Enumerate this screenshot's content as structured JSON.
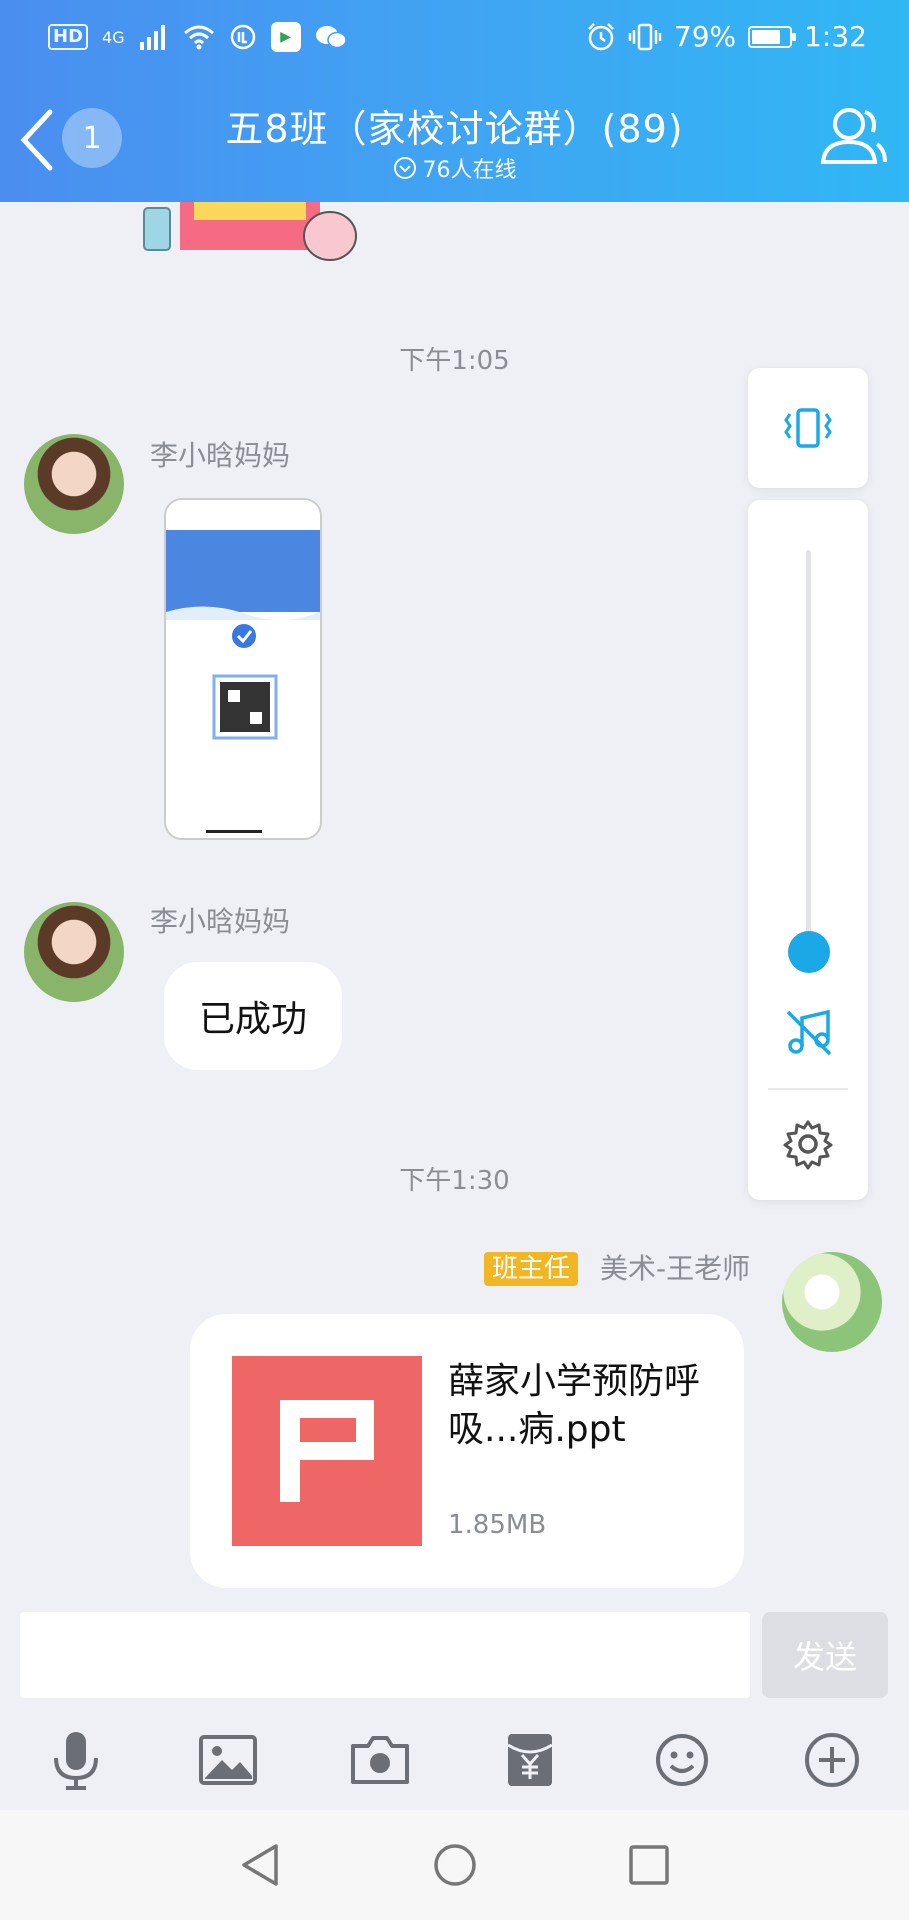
{
  "status_bar": {
    "hd": "HD",
    "network": "4G",
    "battery_percent": "79%",
    "battery_level": 0.79,
    "time": "1:32"
  },
  "header": {
    "back_badge": "1",
    "title": "五8班（家校讨论群）(89)",
    "online": "76人在线"
  },
  "messages": [
    {
      "type": "time",
      "text": "下午1:05"
    },
    {
      "type": "image",
      "sender": "李小晗妈妈"
    },
    {
      "type": "text",
      "sender": "李小晗妈妈",
      "text": "已成功"
    },
    {
      "type": "time",
      "text": "下午1:30"
    },
    {
      "type": "file",
      "role_badge": "班主任",
      "sender": "美术-王老师",
      "file_name": "薛家小学预防呼吸...病.ppt",
      "file_size": "1.85MB"
    }
  ],
  "volume_panel": {
    "level": 0.0
  },
  "input": {
    "placeholder": "",
    "send_label": "发送"
  },
  "toolbar": [
    "mic-icon",
    "image-icon",
    "camera-icon",
    "red-packet-icon",
    "emoji-icon",
    "plus-icon"
  ],
  "colors": {
    "header_start": "#4a8ef0",
    "header_end": "#30b7f4",
    "accent": "#1ba8e6",
    "ppt": "#ee6766",
    "role_badge": "#f1b623"
  }
}
